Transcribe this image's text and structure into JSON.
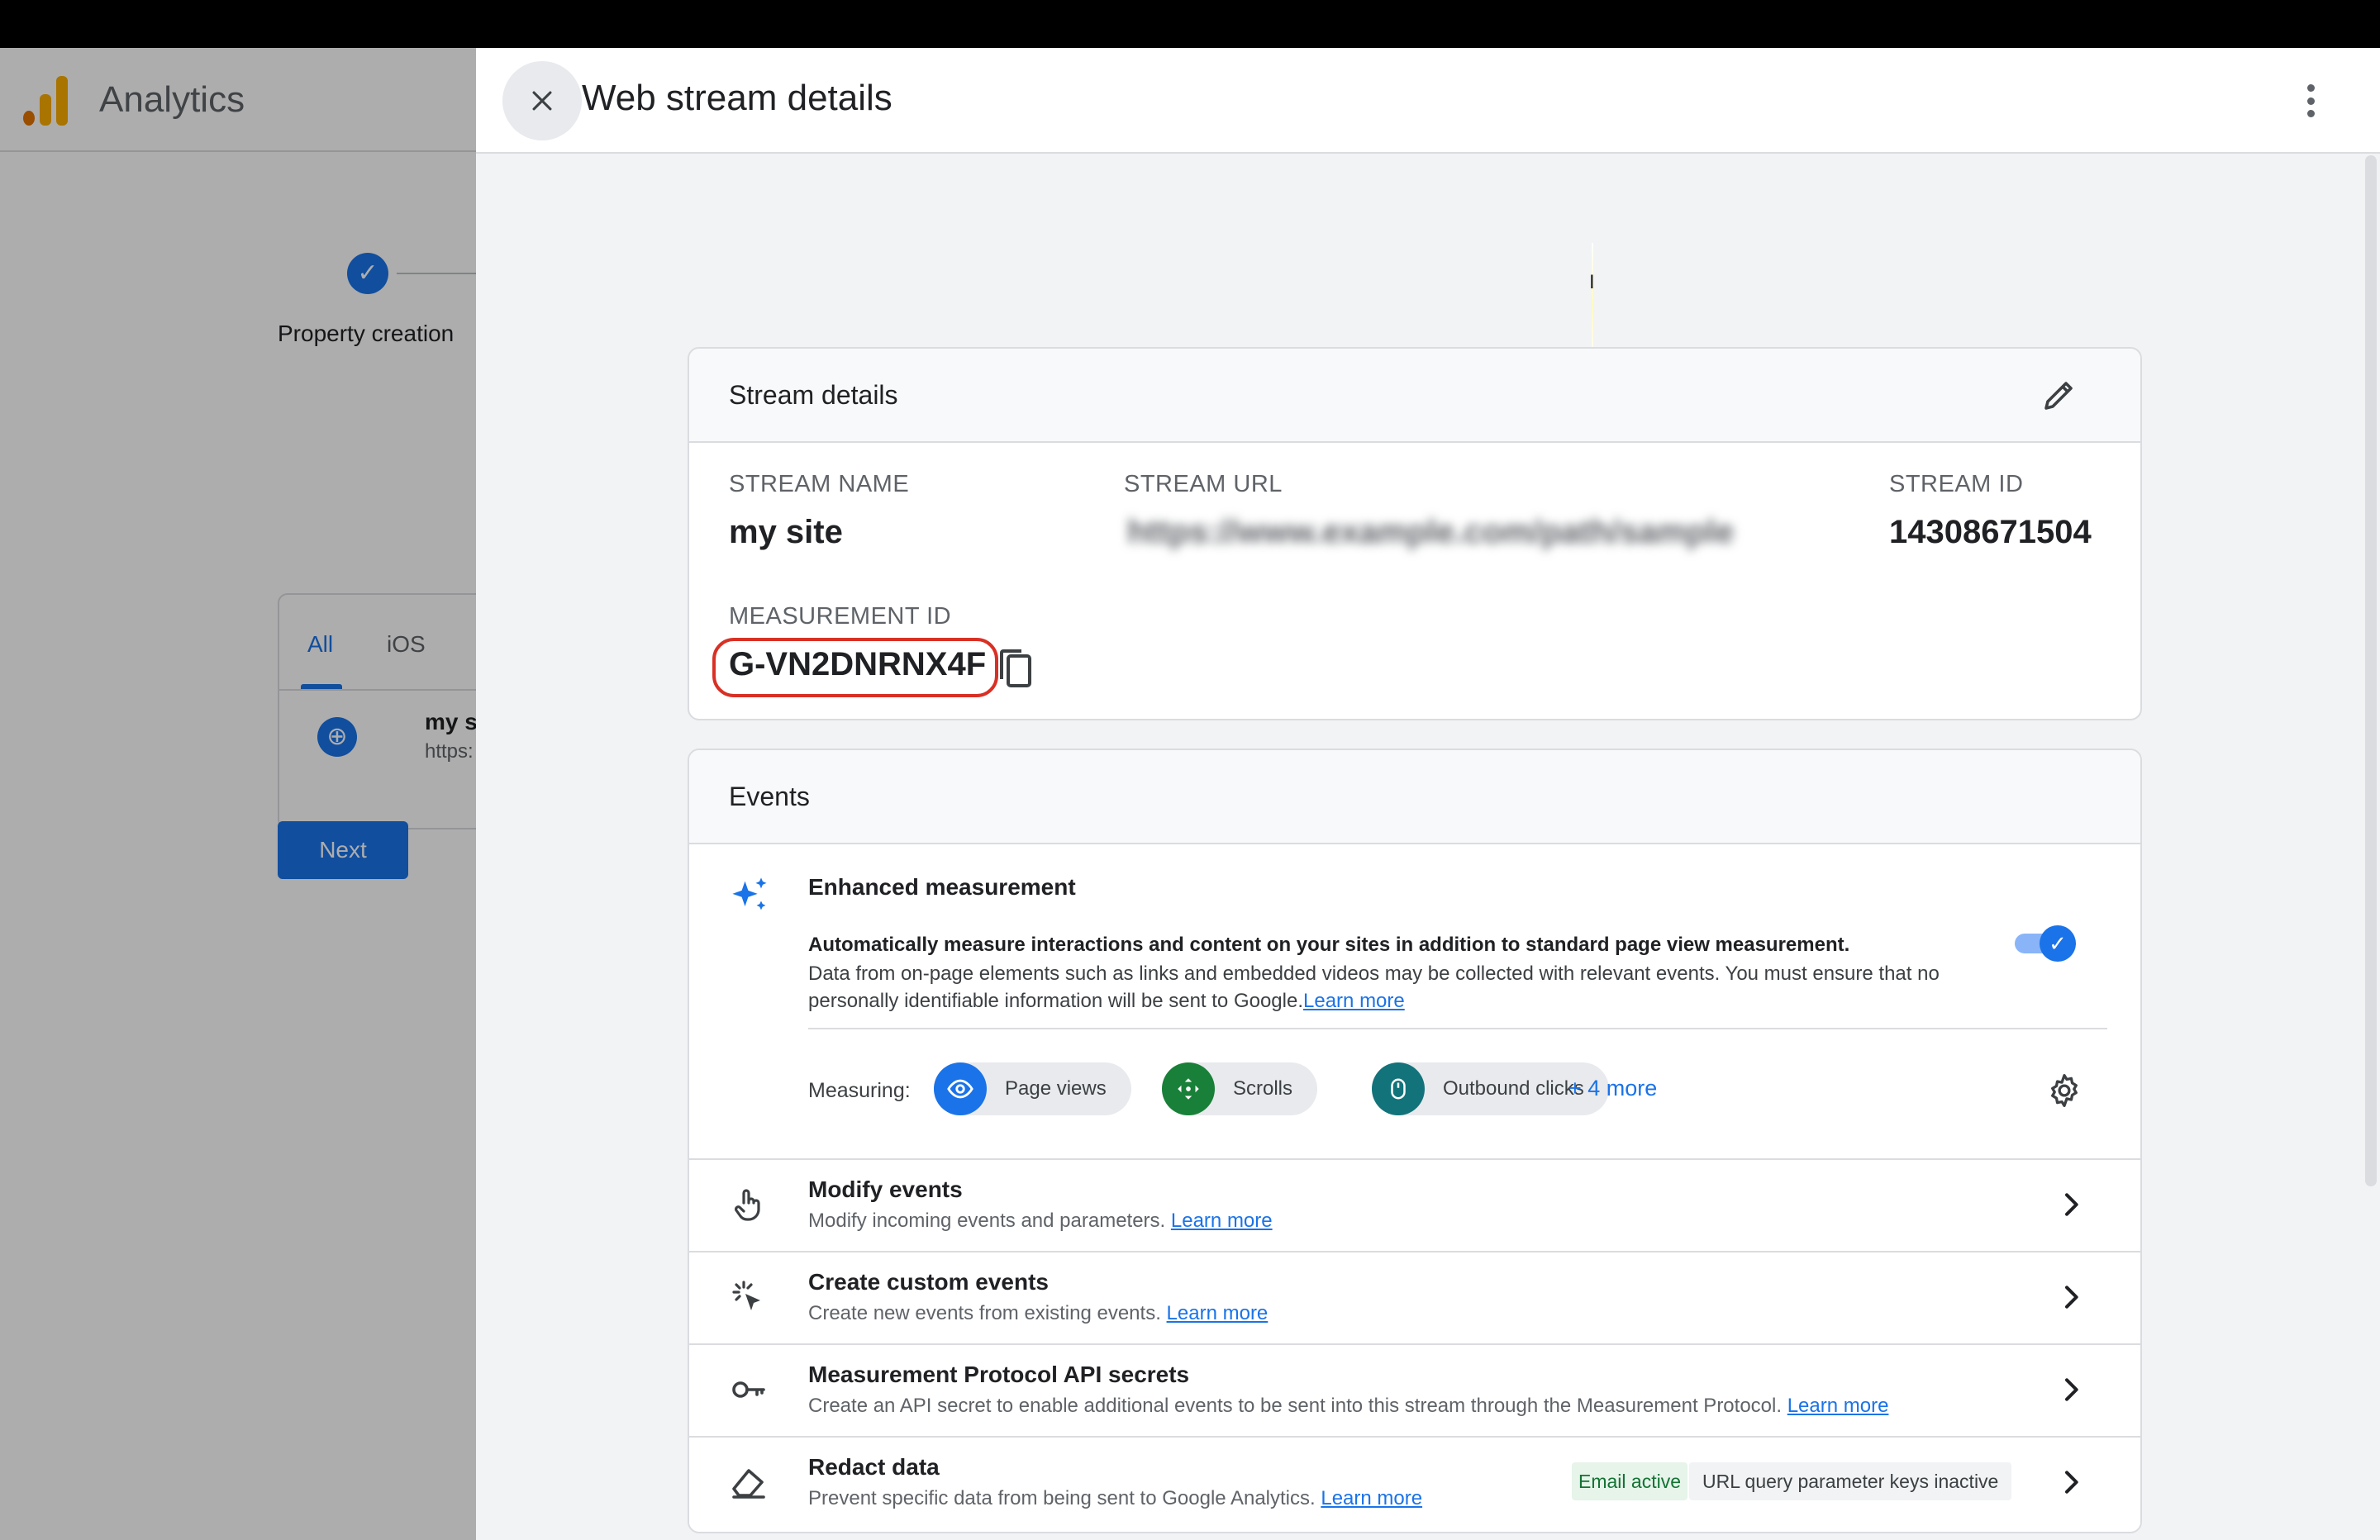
{
  "app": {
    "name": "Analytics"
  },
  "background": {
    "stepper_label": "Property creation",
    "tabs": [
      "All",
      "iOS"
    ],
    "stream_item": {
      "name": "my s",
      "url": "https:"
    },
    "next_button": "Next"
  },
  "panel": {
    "title": "Web stream details",
    "stream_details": {
      "heading": "Stream details",
      "stream_name_label": "STREAM NAME",
      "stream_name": "my site",
      "stream_url_label": "STREAM URL",
      "stream_url": "https://www.example.com/path/sample",
      "stream_id_label": "STREAM ID",
      "stream_id": "14308671504",
      "measurement_id_label": "MEASUREMENT ID",
      "measurement_id": "G-VN2DNRNX4F"
    },
    "events": {
      "heading": "Events",
      "enhanced": {
        "title": "Enhanced measurement",
        "desc_strong": "Automatically measure interactions and content on your sites in addition to standard page view measurement.",
        "desc": "Data from on-page elements such as links and embedded videos may be collected with relevant events. You must ensure that no personally identifiable information will be sent to Google.",
        "learn_more": "Learn more",
        "enabled": true,
        "measuring_label": "Measuring:",
        "chips": [
          {
            "label": "Page views",
            "icon": "eye-icon",
            "color": "#1a73e8"
          },
          {
            "label": "Scrolls",
            "icon": "scroll-icon",
            "color": "#188038"
          },
          {
            "label": "Outbound clicks",
            "icon": "mouse-icon",
            "color": "#12737a"
          }
        ],
        "more": "+ 4 more"
      },
      "rows": [
        {
          "title": "Modify events",
          "sub": "Modify incoming events and parameters.",
          "link": "Learn more"
        },
        {
          "title": "Create custom events",
          "sub": "Create new events from existing events.",
          "link": "Learn more"
        },
        {
          "title": "Measurement Protocol API secrets",
          "sub": "Create an API secret to enable additional events to be sent into this stream through the Measurement Protocol.",
          "link": "Learn more"
        },
        {
          "title": "Redact data",
          "sub": "Prevent specific data from being sent to Google Analytics.",
          "link": "Learn more",
          "badges": [
            "Email active",
            "URL query parameter keys inactive"
          ]
        }
      ]
    }
  },
  "colors": {
    "accent": "#1a73e8",
    "highlight": "#d93025",
    "logo_orange": "#f9ab00",
    "logo_dark": "#e37400"
  }
}
